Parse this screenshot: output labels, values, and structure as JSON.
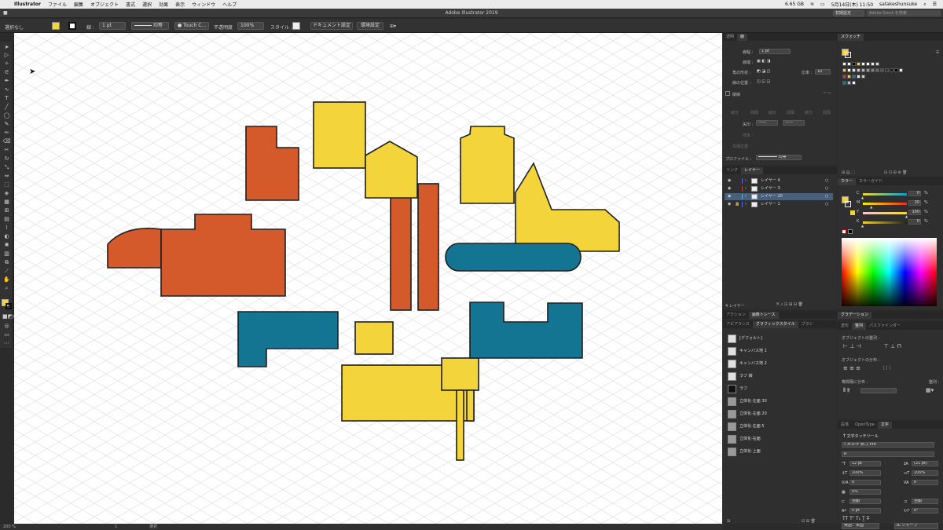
{
  "menubar": {
    "apple": "",
    "app_name": "Illustrator",
    "items": [
      "ファイル",
      "編集",
      "オブジェクト",
      "書式",
      "選択",
      "効果",
      "表示",
      "ウィンドウ",
      "ヘルプ"
    ],
    "memory": "6.65 GB",
    "datetime": "5月14日(木) 11:50",
    "user": "satakeshunsuke"
  },
  "titlebar": {
    "title": "Adobe Illustrator 2019",
    "home": "■",
    "workspace": "初期設定",
    "stock_search_placeholder": "Adobe Stock を検索"
  },
  "controlbar": {
    "selection_status": "選択なし",
    "stroke_label": "線 :",
    "stroke_weight": "1 pt",
    "stroke_profile": "均等",
    "brush": "Touch C...",
    "opacity_label": "不透明度",
    "opacity_value": "100%",
    "style_label": "スタイル :",
    "doc_setup_button": "ドキュメント設定",
    "preferences_button": "環境設定"
  },
  "statusbar": {
    "zoom": "200 %",
    "artboard": "1",
    "tool": "選択"
  },
  "stroke_panel": {
    "tabs": [
      "透明",
      "線"
    ],
    "weight_label": "線幅 :",
    "weight_value": "1 pt",
    "cap_label": "線端 :",
    "corner_label": "角の形状 :",
    "limit_label": "比率 :",
    "limit_value": "10",
    "align_label": "線の位置 :",
    "dashed_label": "破線",
    "dash_labels": [
      "線分",
      "間隔",
      "線分",
      "間隔",
      "線分",
      "間隔"
    ],
    "arrow_label": "矢印 :",
    "scale_label": "倍率 :",
    "arrow_align_label": "先端位置 :",
    "profile_label": "プロファイル :",
    "profile_value": "均等"
  },
  "layers_panel": {
    "tabs": [
      "リンク",
      "レイヤー"
    ],
    "layers": [
      {
        "name": "レイヤー 4",
        "color": "#4f6cff",
        "selected": false,
        "locked": false
      },
      {
        "name": "レイヤー 3",
        "color": "#d43a3a",
        "selected": false,
        "locked": false
      },
      {
        "name": "レイヤー 20",
        "color": "#3ac0d4",
        "selected": true,
        "locked": false
      },
      {
        "name": "レイヤー 1",
        "color": "#4f6cff",
        "selected": false,
        "locked": true
      }
    ],
    "count_label": "4 レイヤー"
  },
  "graphic_styles_panel": {
    "top_tabs": [
      "アクション",
      "画像トレース"
    ],
    "tabs": [
      "アピアランス",
      "グラフィックスタイル",
      "ブラシ"
    ],
    "styles": [
      "[デフォルト]",
      "キャンバス地 1",
      "キャンバス地 2",
      "ラフ 線",
      "ラフ",
      "立体化-左面 30",
      "立体化-左面 20",
      "立体化-左面 5",
      "立体化-右面",
      "立体化-上面"
    ]
  },
  "swatches_panel": {
    "tab": "スウォッチ"
  },
  "color_panel": {
    "tabs": [
      "カラー",
      "カラーガイド"
    ],
    "channels": [
      {
        "label": "C",
        "value": "0",
        "fraction": 0.0
      },
      {
        "label": "M",
        "value": "20",
        "fraction": 0.2
      },
      {
        "label": "Y",
        "value": "100",
        "fraction": 1.0
      },
      {
        "label": "K",
        "value": "0",
        "fraction": 0.0
      }
    ],
    "unit": "%"
  },
  "gradient_panel": {
    "tab": "グラデーション"
  },
  "align_panel": {
    "tabs": [
      "変形",
      "整列",
      "パスファインダー"
    ],
    "align_objects_label": "オブジェクトの整列 :",
    "distribute_objects_label": "オブジェクトの分布 :",
    "distribute_spacing_label": "等間隔に分布 :",
    "align_to_label": "整列 :"
  },
  "character_panel": {
    "tabs": [
      "段落",
      "OpenType",
      "文字"
    ],
    "touch_type_tool": "文字タッチツール",
    "font_family": "A-OTF 新ゴ Pro",
    "font_style": "R",
    "font_size": "12 pt",
    "leading": "(21 pt)",
    "vertical_scale": "100%",
    "horizontal_scale": "100%",
    "kerning": "0",
    "tracking": "0",
    "tsume": "0%",
    "aki_left": "自動",
    "aki_right": "自動",
    "baseline_shift": "0 pt",
    "rotation": "0°",
    "language": "英語：米国",
    "antialias": "シャープ"
  },
  "colors": {
    "orange": "#d4592b",
    "yellow": "#f3d43a",
    "teal": "#137591",
    "stroke": "#1f1f1f"
  }
}
